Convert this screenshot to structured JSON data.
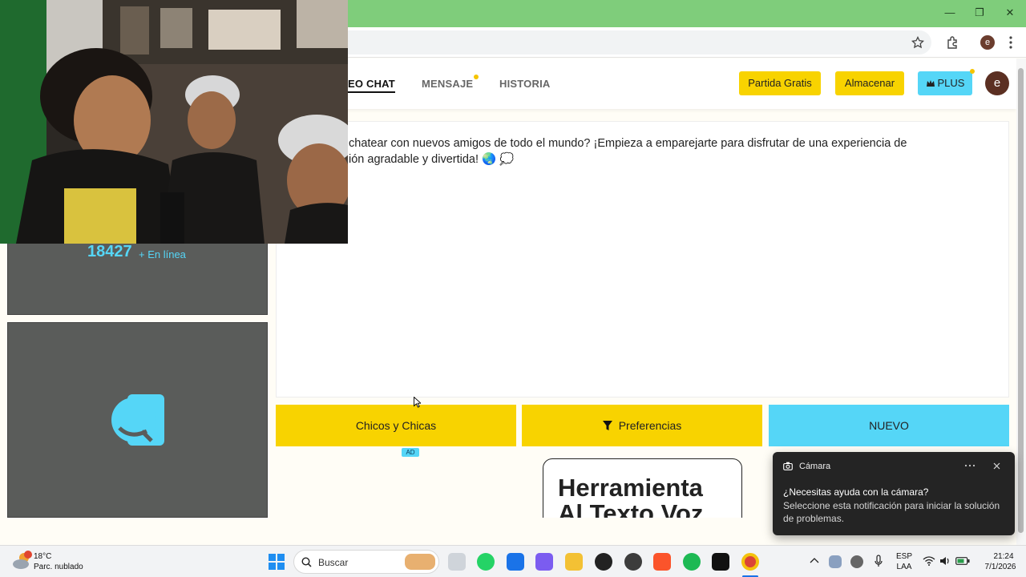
{
  "browser": {
    "window_controls": [
      "—",
      "❐",
      "✕"
    ]
  },
  "nav": {
    "tabs": [
      "EO CHAT",
      "MENSAJE",
      "HISTORIA"
    ],
    "buttons": {
      "partida": "Partida Gratis",
      "almacenar": "Almacenar",
      "plus": "PLUS",
      "plus_icon": "crown-icon"
    },
    "avatar_letter": "e"
  },
  "chat": {
    "welcome_line1": "chatear con nuevos amigos de todo el mundo? ¡Empieza a emparejarte para disfrutar de una experiencia de",
    "welcome_line2": "ión agradable y divertida! 🌏 💭"
  },
  "sidebar": {
    "online_count": "18427",
    "online_label": "+ En línea"
  },
  "actions": {
    "gender": "Chicos y Chicas",
    "preferences": "Preferencias",
    "new": "NUEVO",
    "ad_badge": "AD"
  },
  "ad": {
    "line1": "Herramienta",
    "line2": "Al Texto Voz"
  },
  "notification": {
    "app": "Cámara",
    "title": "¿Necesitas ayuda con la cámara?",
    "body": "Seleccione esta notificación para iniciar la solución de problemas."
  },
  "taskbar": {
    "weather_temp": "18°C",
    "weather_desc": "Parc. nublado",
    "search_placeholder": "Buscar",
    "lang1": "ESP",
    "lang2": "LAA",
    "time": "21:24",
    "date": "7/1/2026"
  },
  "colors": {
    "accent_yellow": "#f8d300",
    "accent_cyan": "#55d6f7",
    "titlebar_green": "#7fcd7b"
  }
}
